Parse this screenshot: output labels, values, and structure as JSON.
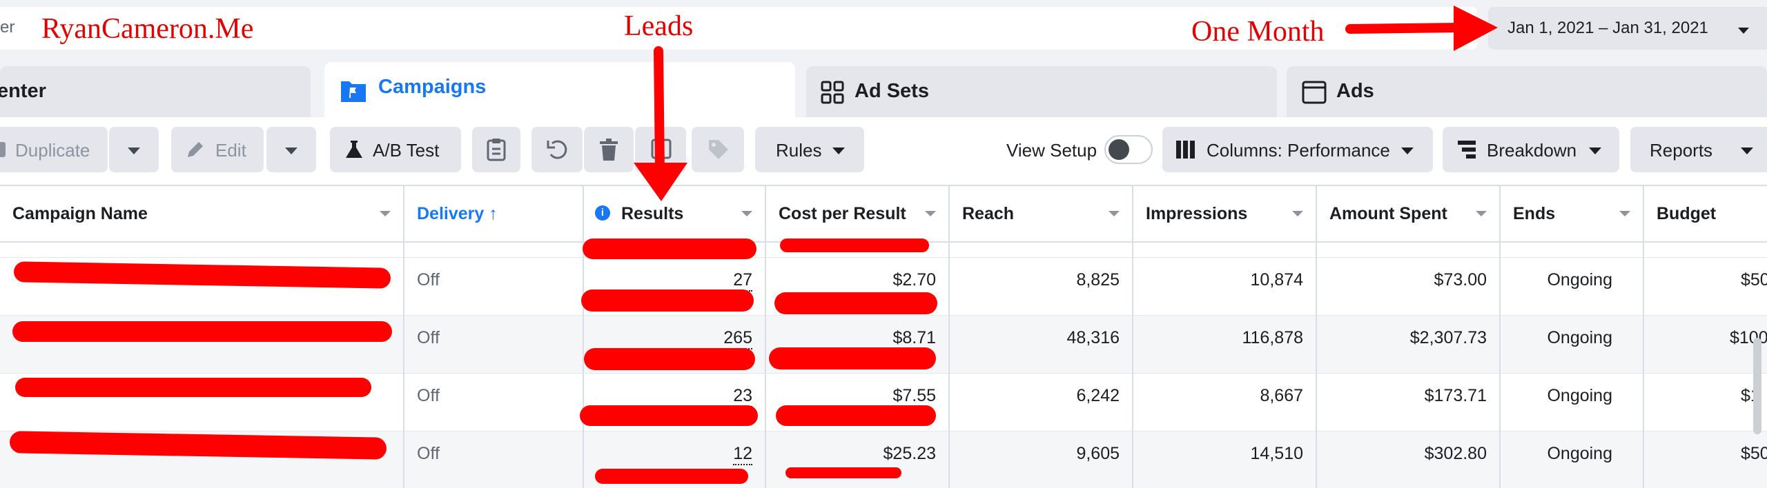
{
  "topbar": {
    "search_tail": "er",
    "date_range": "Jan 1, 2021 – Jan 31, 2021"
  },
  "tabs": [
    {
      "label": "enter",
      "active": false
    },
    {
      "label": "Campaigns",
      "active": true
    },
    {
      "label": "Ad Sets",
      "active": false
    },
    {
      "label": "Ads",
      "active": false
    }
  ],
  "toolbar": {
    "duplicate": "Duplicate",
    "edit": "Edit",
    "ab_test": "A/B Test",
    "rules": "Rules",
    "view_setup": "View Setup",
    "view_setup_on": false,
    "columns": "Columns: Performance",
    "breakdown": "Breakdown",
    "reports": "Reports"
  },
  "table": {
    "headers": [
      "Campaign Name",
      "Delivery ↑",
      "Results",
      "Cost per Result",
      "Reach",
      "Impressions",
      "Amount Spent",
      "Ends",
      "Budget"
    ],
    "rows": [
      {
        "delivery": "Off",
        "results": "27",
        "cost": "$2.70",
        "reach": "8,825",
        "impressions": "10,874",
        "spent": "$73.00",
        "ends": "Ongoing",
        "budget": "$50"
      },
      {
        "delivery": "Off",
        "results": "265",
        "cost": "$8.71",
        "reach": "48,316",
        "impressions": "116,878",
        "spent": "$2,307.73",
        "ends": "Ongoing",
        "budget": "$100"
      },
      {
        "delivery": "Off",
        "results": "23",
        "cost": "$7.55",
        "reach": "6,242",
        "impressions": "8,667",
        "spent": "$173.71",
        "ends": "Ongoing",
        "budget": "$1"
      },
      {
        "delivery": "Off",
        "results": "12",
        "cost": "$25.23",
        "reach": "9,605",
        "impressions": "14,510",
        "spent": "$302.80",
        "ends": "Ongoing",
        "budget": "$50"
      }
    ]
  },
  "annotations": {
    "site": "RyanCameron.Me",
    "leads": "Leads",
    "period": "One Month"
  },
  "colors": {
    "accent": "#1877f2",
    "annotation": "#e00000",
    "button_bg": "#e4e6eb"
  }
}
